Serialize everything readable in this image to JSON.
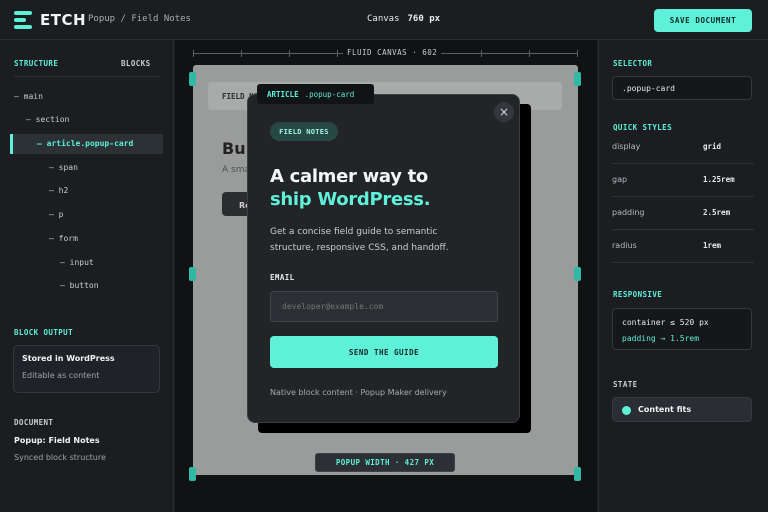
{
  "topbar": {
    "brand": "ETCH",
    "breadcrumb": "Popup / Field Notes",
    "canvas_label": "Canvas",
    "canvas_width": "760 px",
    "save_label": "SAVE DOCUMENT"
  },
  "left": {
    "tab_structure": "STRUCTURE",
    "tab_blocks": "BLOCKS",
    "tree": [
      {
        "label": "— main"
      },
      {
        "label": "— section"
      },
      {
        "label": "— article.popup-card",
        "selected": true
      },
      {
        "label": "— span"
      },
      {
        "label": "— h2"
      },
      {
        "label": "— p"
      },
      {
        "label": "— form"
      },
      {
        "label": "— input"
      },
      {
        "label": "— button"
      }
    ],
    "block_output_title": "BLOCK OUTPUT",
    "block_output_main": "Stored in WordPress",
    "block_output_sub": "Editable as content",
    "document_title": "DOCUMENT",
    "document_name": "Popup: Field Notes",
    "document_sub": "Synced block structure"
  },
  "canvas": {
    "ruler_label": "FLUID CANVAS · 602",
    "bg_label": "FIELD NO",
    "bg_heading": "Buil",
    "bg_sub": "A sma",
    "bg_button": "Re",
    "width_badge": "POPUP WIDTH · 427 PX"
  },
  "popup": {
    "tag_element": "ARTICLE",
    "tag_class": ".popup-card",
    "close_symbol": "×",
    "pill": "FIELD NOTES",
    "heading_line1": "A calmer way to",
    "heading_line2": "ship WordPress.",
    "description": "Get a concise field guide to semantic structure, responsive CSS, and handoff.",
    "email_label": "EMAIL",
    "email_placeholder": "developer@example.com",
    "send_label": "SEND THE GUIDE",
    "footer": "Native block content · Popup Maker delivery"
  },
  "right": {
    "selector_title": "SELECTOR",
    "selector_value": ".popup-card",
    "quick_styles_title": "QUICK STYLES",
    "styles": [
      {
        "key": "display",
        "value": "grid"
      },
      {
        "key": "gap",
        "value": "1.25rem"
      },
      {
        "key": "padding",
        "value": "2.5rem"
      },
      {
        "key": "radius",
        "value": "1rem"
      }
    ],
    "responsive_title": "RESPONSIVE",
    "responsive_rule": "container ≤ 520 px",
    "responsive_effect": "padding → 1.5rem",
    "state_title": "STATE",
    "state_value": "Content fits"
  },
  "colors": {
    "accent": "#5ef0d8",
    "background": "#1b1d21",
    "canvas": "#101214"
  }
}
